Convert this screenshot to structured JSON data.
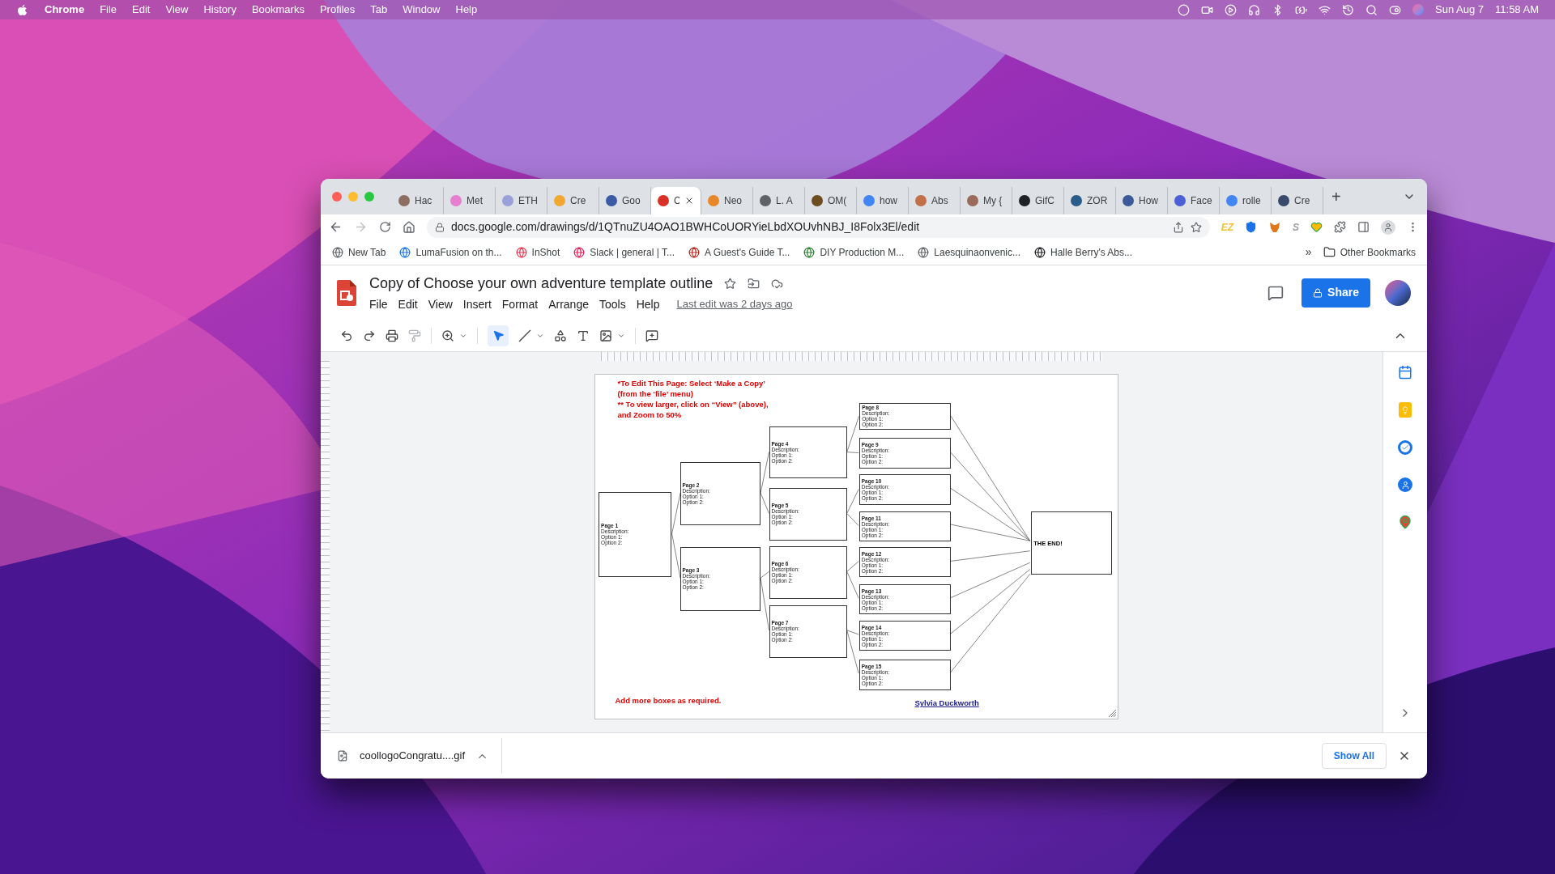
{
  "menubar": {
    "items": [
      {
        "label": "Chrome",
        "kind": "app"
      },
      {
        "label": "File",
        "kind": "menu"
      },
      {
        "label": "Edit",
        "kind": "menu"
      },
      {
        "label": "View",
        "kind": "menu"
      },
      {
        "label": "History",
        "kind": "menu"
      },
      {
        "label": "Bookmarks",
        "kind": "menu"
      },
      {
        "label": "Profiles",
        "kind": "menu"
      },
      {
        "label": "Tab",
        "kind": "menu"
      },
      {
        "label": "Window",
        "kind": "menu"
      },
      {
        "label": "Help",
        "kind": "menu"
      }
    ],
    "date": "Sun Aug 7",
    "time": "11:58 AM"
  },
  "tabs": [
    {
      "label": "Hac",
      "selected": false,
      "color": "#8d6e63"
    },
    {
      "label": "Met",
      "selected": false,
      "color": "#e57fd0"
    },
    {
      "label": "ETH",
      "selected": false,
      "color": "#9aa0d8"
    },
    {
      "label": "Cre",
      "selected": false,
      "color": "#f0a830"
    },
    {
      "label": "Goo",
      "selected": false,
      "color": "#3b5ba5"
    },
    {
      "label": "C",
      "selected": true,
      "color": "#d93025"
    },
    {
      "label": "Neo",
      "selected": false,
      "color": "#e8872a"
    },
    {
      "label": "L. A",
      "selected": false,
      "color": "#5f6368"
    },
    {
      "label": "OM(",
      "selected": false,
      "color": "#6d4c1f"
    },
    {
      "label": "how",
      "selected": false,
      "color": "#4285f4"
    },
    {
      "label": "Abs",
      "selected": false,
      "color": "#c0714a"
    },
    {
      "label": "My {",
      "selected": false,
      "color": "#9a6a5a"
    },
    {
      "label": "GifC",
      "selected": false,
      "color": "#202124"
    },
    {
      "label": "ZOR",
      "selected": false,
      "color": "#2a5c8a"
    },
    {
      "label": "How",
      "selected": false,
      "color": "#3c5a99"
    },
    {
      "label": "Face",
      "selected": false,
      "color": "#4b5fd6"
    },
    {
      "label": "rolle",
      "selected": false,
      "color": "#4285f4"
    },
    {
      "label": "Cre",
      "selected": false,
      "color": "#3a4a6b"
    }
  ],
  "new_tab": "+",
  "address": "docs.google.com/drawings/d/1QTnuZU4OAO1BWHCoUORYieLbdXOUvhNBJ_I8Folx3El/edit",
  "extensions": [
    {
      "label": "EZ",
      "color": "#f2c12e"
    },
    {
      "label": "S",
      "color": "#9aa0a6"
    }
  ],
  "bookmarks": [
    {
      "label": "New Tab",
      "color": "#5f6368"
    },
    {
      "label": "LumaFusion on th...",
      "color": "#1a73e8"
    },
    {
      "label": "InShot",
      "color": "#e8344e"
    },
    {
      "label": "Slack | general | T...",
      "color": "#e01e5a"
    },
    {
      "label": "A Guest's Guide T...",
      "color": "#b3261e"
    },
    {
      "label": "DIY Production M...",
      "color": "#2e7d32"
    },
    {
      "label": "Laesquinaonvenic...",
      "color": "#5f6368"
    },
    {
      "label": "Halle Berry's Abs...",
      "color": "#202124"
    }
  ],
  "bookmarks_more": "»",
  "other_bookmarks": "Other Bookmarks",
  "doc": {
    "title": "Copy of Choose your own adventure template outline",
    "menu": [
      "File",
      "Edit",
      "View",
      "Insert",
      "Format",
      "Arrange",
      "Tools",
      "Help"
    ],
    "last_edit": "Last edit was 2 days ago",
    "share": "Share"
  },
  "drawing": {
    "instructions": [
      "*To Edit This Page: Select ‘Make a Copy’",
      "(from the ‘file’ menu)",
      "** To view larger, click on “View” (above),",
      "and Zoom to 50%"
    ],
    "boxes": [
      {
        "title": "Page 1",
        "lines": [
          "Description:",
          "Option 1:",
          "Option 2:"
        ]
      },
      {
        "title": "Page 2",
        "lines": [
          "Description:",
          "Option 1:",
          "Option 2:"
        ]
      },
      {
        "title": "Page 3",
        "lines": [
          "Description:",
          "Option 1:",
          "Option 2:"
        ]
      },
      {
        "title": "Page 4",
        "lines": [
          "Description:",
          "Option 1:",
          "Option 2:"
        ]
      },
      {
        "title": "Page 5",
        "lines": [
          "Description:",
          "Option 1:",
          "Option 2:"
        ]
      },
      {
        "title": "Page 6",
        "lines": [
          "Description:",
          "Option 1:",
          "Option 2:"
        ]
      },
      {
        "title": "Page 7",
        "lines": [
          "Description:",
          "Option 1:",
          "Option 2:"
        ]
      },
      {
        "title": "Page 8",
        "lines": [
          "Description:",
          "Option 1:",
          "Option 2:"
        ]
      },
      {
        "title": "Page 9",
        "lines": [
          "Description:",
          "Option 1:",
          "Option 2:"
        ]
      },
      {
        "title": "Page 10",
        "lines": [
          "Description:",
          "Option 1:",
          "Option 2:"
        ]
      },
      {
        "title": "Page 11",
        "lines": [
          "Description:",
          "Option 1:",
          "Option 2:"
        ]
      },
      {
        "title": "Page 12",
        "lines": [
          "Description:",
          "Option 1:",
          "Option 2:"
        ]
      },
      {
        "title": "Page 13",
        "lines": [
          "Description:",
          "Option 1:",
          "Option 2:"
        ]
      },
      {
        "title": "Page 14",
        "lines": [
          "Description:",
          "Option 1:",
          "Option 2:"
        ]
      },
      {
        "title": "Page 15",
        "lines": [
          "Description:",
          "Option 1:",
          "Option 2:"
        ]
      }
    ],
    "end_box": "THE END!",
    "note": "Add more boxes as required.",
    "author": "Sylvia Duckworth"
  },
  "download": {
    "file": "coollogoCongratu....gif",
    "show_all": "Show All"
  }
}
